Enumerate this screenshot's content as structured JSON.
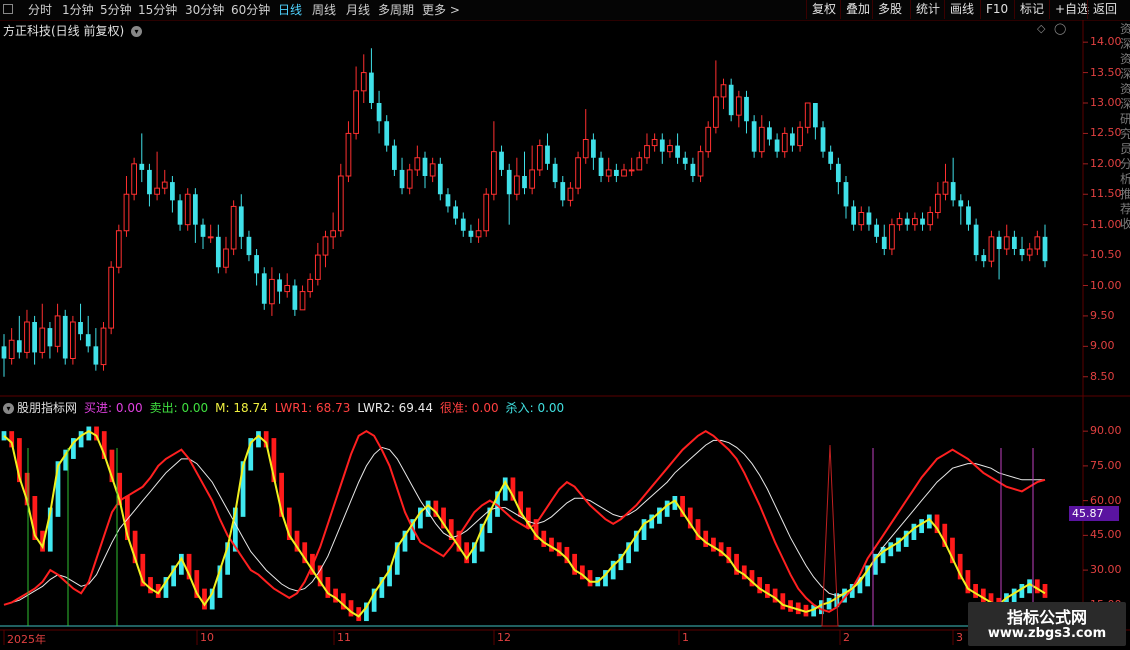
{
  "toolbar": {
    "periods": [
      "分时",
      "1分钟",
      "5分钟",
      "15分钟",
      "30分钟",
      "60分钟",
      "日线",
      "周线",
      "月线",
      "多周期",
      "更多"
    ],
    "active": "日线",
    "right_buttons": [
      "复权",
      "叠加",
      "多股",
      "统计",
      "画线",
      "F10",
      "标记",
      "+自选",
      "返回"
    ]
  },
  "main_pane": {
    "title": "方正科技(日线 前复权)",
    "y_labels": [
      "14.00",
      "13.50",
      "13.00",
      "12.50",
      "12.00",
      "11.50",
      "11.00",
      "10.50",
      "10.00",
      "9.50",
      "9.00",
      "8.50"
    ]
  },
  "indicator_pane": {
    "name": "股朋指标网",
    "items": [
      {
        "label": "买进:",
        "value": "0.00",
        "color": "#e040e0"
      },
      {
        "label": "卖出:",
        "value": "0.00",
        "color": "#40e040"
      },
      {
        "label": "M:",
        "value": "18.74",
        "color": "#f0f040"
      },
      {
        "label": "LWR1:",
        "value": "68.73",
        "color": "#ff4040"
      },
      {
        "label": "LWR2:",
        "value": "69.44",
        "color": "#e8e8e8"
      },
      {
        "label": "很准:",
        "value": "0.00",
        "color": "#ff4040"
      },
      {
        "label": "杀入:",
        "value": "0.00",
        "color": "#40e0e0"
      }
    ],
    "y_labels": [
      "90.00",
      "75.00",
      "60.00",
      "45.00",
      "30.00",
      "15.00"
    ],
    "highlight_value": "45.87"
  },
  "x_axis": {
    "labels": [
      "2025年",
      "10",
      "11",
      "12",
      "1",
      "2",
      "3"
    ]
  },
  "side_text": "资深资深资深研究员分析推荐收",
  "watermark": {
    "title": "指标公式网",
    "url": "www.zbgs3.com"
  },
  "colors": {
    "up": "#ff3030",
    "down": "#40e0e8",
    "bg": "#000000",
    "grid": "#5a0000"
  },
  "chart_data": {
    "type": "candlestick",
    "ylim": [
      8.2,
      14.2
    ],
    "indicator_ylim": [
      5,
      100
    ],
    "candles": [
      [
        9.0,
        8.8,
        9.2,
        8.5
      ],
      [
        8.8,
        9.1,
        9.3,
        8.7
      ],
      [
        9.1,
        8.9,
        9.5,
        8.8
      ],
      [
        8.9,
        9.4,
        9.6,
        8.8
      ],
      [
        9.4,
        8.9,
        9.5,
        8.7
      ],
      [
        8.9,
        9.3,
        9.7,
        8.8
      ],
      [
        9.3,
        9.0,
        9.4,
        8.8
      ],
      [
        9.0,
        9.5,
        9.7,
        8.9
      ],
      [
        9.5,
        8.8,
        9.6,
        8.7
      ],
      [
        8.8,
        9.4,
        9.5,
        8.7
      ],
      [
        9.4,
        9.2,
        9.7,
        9.1
      ],
      [
        9.2,
        9.0,
        9.5,
        8.9
      ],
      [
        9.0,
        8.7,
        9.3,
        8.6
      ],
      [
        8.7,
        9.3,
        9.4,
        8.6
      ],
      [
        9.3,
        10.3,
        10.4,
        9.2
      ],
      [
        10.3,
        10.9,
        11.0,
        10.2
      ],
      [
        10.9,
        11.5,
        11.8,
        10.8
      ],
      [
        11.5,
        12.0,
        12.1,
        11.4
      ],
      [
        12.0,
        11.9,
        12.5,
        11.7
      ],
      [
        11.9,
        11.5,
        12.0,
        11.3
      ],
      [
        11.5,
        11.6,
        12.2,
        11.4
      ],
      [
        11.6,
        11.7,
        11.9,
        11.5
      ],
      [
        11.7,
        11.4,
        11.8,
        11.2
      ],
      [
        11.4,
        11.0,
        11.5,
        10.9
      ],
      [
        11.0,
        11.5,
        11.6,
        10.9
      ],
      [
        11.5,
        11.0,
        11.6,
        10.7
      ],
      [
        11.0,
        10.8,
        11.1,
        10.6
      ],
      [
        10.8,
        10.8,
        11.0,
        10.7
      ],
      [
        10.8,
        10.3,
        11.0,
        10.2
      ],
      [
        10.3,
        10.6,
        10.8,
        10.2
      ],
      [
        10.6,
        11.3,
        11.4,
        10.5
      ],
      [
        11.3,
        10.8,
        11.5,
        10.6
      ],
      [
        10.8,
        10.5,
        10.9,
        10.4
      ],
      [
        10.5,
        10.2,
        10.6,
        10.0
      ],
      [
        10.2,
        9.7,
        10.3,
        9.6
      ],
      [
        9.7,
        10.1,
        10.3,
        9.5
      ],
      [
        10.1,
        9.9,
        10.2,
        9.7
      ],
      [
        9.9,
        10.0,
        10.2,
        9.8
      ],
      [
        10.0,
        9.6,
        10.1,
        9.5
      ],
      [
        9.6,
        9.9,
        10.0,
        9.6
      ],
      [
        9.9,
        10.1,
        10.2,
        9.8
      ],
      [
        10.1,
        10.5,
        10.7,
        10.0
      ],
      [
        10.5,
        10.8,
        10.9,
        10.3
      ],
      [
        10.8,
        10.9,
        11.2,
        10.6
      ],
      [
        10.9,
        11.8,
        12.0,
        10.8
      ],
      [
        11.8,
        12.5,
        12.7,
        11.7
      ],
      [
        12.5,
        13.2,
        13.6,
        12.4
      ],
      [
        13.2,
        13.5,
        13.8,
        13.0
      ],
      [
        13.5,
        13.0,
        13.9,
        12.9
      ],
      [
        13.0,
        12.7,
        13.2,
        12.5
      ],
      [
        12.7,
        12.3,
        12.8,
        12.2
      ],
      [
        12.3,
        11.9,
        12.4,
        11.8
      ],
      [
        11.9,
        11.6,
        12.1,
        11.5
      ],
      [
        11.6,
        11.9,
        12.0,
        11.5
      ],
      [
        11.9,
        12.1,
        12.3,
        11.8
      ],
      [
        12.1,
        11.8,
        12.2,
        11.6
      ],
      [
        11.8,
        12.0,
        12.1,
        11.7
      ],
      [
        12.0,
        11.5,
        12.1,
        11.4
      ],
      [
        11.5,
        11.3,
        11.6,
        11.2
      ],
      [
        11.3,
        11.1,
        11.4,
        11.0
      ],
      [
        11.1,
        10.9,
        11.2,
        10.8
      ],
      [
        10.9,
        10.8,
        11.0,
        10.7
      ],
      [
        10.8,
        10.9,
        11.1,
        10.7
      ],
      [
        10.9,
        11.5,
        11.6,
        10.8
      ],
      [
        11.5,
        12.2,
        12.7,
        11.4
      ],
      [
        12.2,
        11.9,
        12.3,
        11.8
      ],
      [
        11.9,
        11.5,
        12.0,
        11.0
      ],
      [
        11.5,
        11.8,
        12.1,
        11.4
      ],
      [
        11.8,
        11.6,
        12.2,
        11.5
      ],
      [
        11.6,
        11.9,
        12.3,
        11.5
      ],
      [
        11.9,
        12.3,
        12.4,
        11.8
      ],
      [
        12.3,
        12.0,
        12.5,
        11.9
      ],
      [
        12.0,
        11.7,
        12.1,
        11.6
      ],
      [
        11.7,
        11.4,
        11.8,
        11.3
      ],
      [
        11.4,
        11.6,
        11.7,
        11.3
      ],
      [
        11.6,
        12.1,
        12.2,
        11.5
      ],
      [
        12.1,
        12.4,
        12.9,
        12.0
      ],
      [
        12.4,
        12.1,
        12.5,
        11.9
      ],
      [
        12.1,
        11.8,
        12.2,
        11.7
      ],
      [
        11.8,
        11.9,
        12.1,
        11.7
      ],
      [
        11.9,
        11.8,
        12.0,
        11.7
      ],
      [
        11.8,
        11.9,
        12.0,
        11.8
      ],
      [
        11.9,
        11.9,
        12.1,
        11.8
      ],
      [
        11.9,
        12.1,
        12.2,
        11.9
      ],
      [
        12.1,
        12.3,
        12.5,
        12.0
      ],
      [
        12.3,
        12.4,
        12.5,
        12.2
      ],
      [
        12.4,
        12.2,
        12.5,
        12.0
      ],
      [
        12.2,
        12.3,
        12.4,
        12.1
      ],
      [
        12.3,
        12.1,
        12.5,
        12.0
      ],
      [
        12.1,
        12.0,
        12.2,
        11.9
      ],
      [
        12.0,
        11.8,
        12.1,
        11.7
      ],
      [
        11.8,
        12.2,
        12.3,
        11.7
      ],
      [
        12.2,
        12.6,
        12.7,
        12.1
      ],
      [
        12.6,
        13.1,
        13.7,
        12.5
      ],
      [
        13.1,
        13.3,
        13.4,
        12.9
      ],
      [
        13.3,
        12.8,
        13.4,
        12.7
      ],
      [
        12.8,
        13.1,
        13.2,
        12.6
      ],
      [
        13.1,
        12.7,
        13.2,
        12.5
      ],
      [
        12.7,
        12.2,
        12.8,
        12.1
      ],
      [
        12.2,
        12.6,
        12.8,
        12.1
      ],
      [
        12.6,
        12.4,
        12.7,
        12.3
      ],
      [
        12.4,
        12.2,
        12.5,
        12.1
      ],
      [
        12.2,
        12.5,
        12.6,
        12.1
      ],
      [
        12.5,
        12.3,
        12.6,
        12.2
      ],
      [
        12.3,
        12.6,
        12.7,
        12.2
      ],
      [
        12.6,
        13.0,
        13.0,
        12.5
      ],
      [
        13.0,
        12.6,
        13.0,
        12.4
      ],
      [
        12.6,
        12.2,
        12.7,
        12.1
      ],
      [
        12.2,
        12.0,
        12.3,
        11.9
      ],
      [
        12.0,
        11.7,
        12.1,
        11.5
      ],
      [
        11.7,
        11.3,
        11.8,
        11.1
      ],
      [
        11.3,
        11.0,
        11.4,
        10.9
      ],
      [
        11.0,
        11.2,
        11.3,
        10.9
      ],
      [
        11.2,
        11.0,
        11.3,
        10.9
      ],
      [
        11.0,
        10.8,
        11.1,
        10.7
      ],
      [
        10.8,
        10.6,
        11.0,
        10.5
      ],
      [
        10.6,
        11.0,
        11.1,
        10.5
      ],
      [
        11.0,
        11.1,
        11.2,
        10.9
      ],
      [
        11.1,
        11.0,
        11.2,
        10.9
      ],
      [
        11.0,
        11.1,
        11.2,
        10.9
      ],
      [
        11.1,
        11.0,
        11.2,
        10.9
      ],
      [
        11.0,
        11.2,
        11.3,
        10.9
      ],
      [
        11.2,
        11.5,
        11.7,
        11.1
      ],
      [
        11.5,
        11.7,
        12.0,
        11.4
      ],
      [
        11.7,
        11.4,
        12.1,
        11.3
      ],
      [
        11.4,
        11.3,
        11.5,
        11.0
      ],
      [
        11.3,
        11.0,
        11.4,
        10.9
      ],
      [
        11.0,
        10.5,
        11.1,
        10.4
      ],
      [
        10.5,
        10.4,
        10.6,
        10.3
      ],
      [
        10.4,
        10.8,
        10.9,
        10.3
      ],
      [
        10.8,
        10.6,
        10.9,
        10.1
      ],
      [
        10.6,
        10.8,
        11.0,
        10.5
      ],
      [
        10.8,
        10.6,
        10.9,
        10.5
      ],
      [
        10.6,
        10.5,
        10.8,
        10.4
      ],
      [
        10.5,
        10.6,
        10.7,
        10.4
      ],
      [
        10.6,
        10.8,
        10.9,
        10.5
      ],
      [
        10.8,
        10.4,
        11.0,
        10.3
      ]
    ],
    "series": [
      {
        "name": "M",
        "values": [
          88,
          85,
          70,
          60,
          45,
          40,
          55,
          75,
          80,
          85,
          88,
          90,
          88,
          80,
          70,
          60,
          45,
          35,
          25,
          22,
          20,
          25,
          30,
          35,
          28,
          20,
          15,
          20,
          30,
          40,
          55,
          75,
          85,
          88,
          85,
          70,
          55,
          45,
          40,
          35,
          30,
          25,
          20,
          18,
          15,
          12,
          10,
          14,
          20,
          25,
          30,
          40,
          45,
          50,
          55,
          58,
          55,
          50,
          45,
          40,
          35,
          40,
          48,
          55,
          62,
          68,
          62,
          55,
          50,
          45,
          42,
          40,
          38,
          35,
          30,
          28,
          25,
          25,
          28,
          32,
          35,
          40,
          45,
          50,
          52,
          55,
          58,
          60,
          55,
          50,
          45,
          42,
          40,
          38,
          35,
          30,
          28,
          25,
          22,
          20,
          18,
          15,
          14,
          13,
          12,
          13,
          15,
          16,
          18,
          20,
          22,
          25,
          30,
          35,
          38,
          40,
          42,
          45,
          48,
          50,
          52,
          48,
          42,
          35,
          28,
          22,
          20,
          18,
          16,
          15,
          18,
          20,
          22,
          24,
          22,
          20
        ]
      },
      {
        "name": "LWR1",
        "values": [
          15,
          16,
          18,
          20,
          22,
          25,
          30,
          28,
          25,
          22,
          20,
          25,
          35,
          45,
          55,
          60,
          62,
          64,
          66,
          70,
          75,
          78,
          80,
          82,
          78,
          72,
          66,
          60,
          52,
          45,
          40,
          35,
          30,
          28,
          25,
          22,
          20,
          18,
          20,
          25,
          32,
          40,
          50,
          60,
          70,
          80,
          88,
          90,
          88,
          82,
          75,
          65,
          55,
          48,
          42,
          40,
          38,
          36,
          40,
          45,
          50,
          55,
          58,
          60,
          58,
          55,
          52,
          50,
          48,
          50,
          55,
          60,
          65,
          68,
          66,
          62,
          58,
          55,
          52,
          50,
          52,
          55,
          58,
          62,
          66,
          70,
          74,
          78,
          82,
          85,
          88,
          90,
          88,
          85,
          82,
          78,
          72,
          65,
          58,
          50,
          42,
          35,
          28,
          22,
          18,
          15,
          13,
          12,
          14,
          18,
          22,
          28,
          35,
          40,
          45,
          50,
          55,
          60,
          65,
          70,
          74,
          78,
          80,
          82,
          80,
          78,
          75,
          72,
          70,
          68,
          66,
          65,
          64,
          66,
          68,
          69
        ]
      },
      {
        "name": "LWR2",
        "values": [
          15,
          16,
          17,
          19,
          21,
          23,
          26,
          28,
          27,
          25,
          23,
          24,
          28,
          35,
          42,
          48,
          52,
          56,
          60,
          64,
          68,
          72,
          75,
          78,
          78,
          76,
          72,
          68,
          62,
          56,
          50,
          44,
          38,
          34,
          30,
          27,
          24,
          22,
          21,
          22,
          25,
          30,
          36,
          44,
          52,
          60,
          68,
          75,
          80,
          83,
          82,
          78,
          72,
          66,
          60,
          55,
          50,
          46,
          44,
          45,
          47,
          50,
          53,
          56,
          57,
          57,
          55,
          53,
          51,
          50,
          51,
          53,
          56,
          59,
          61,
          61,
          60,
          58,
          56,
          54,
          53,
          54,
          56,
          59,
          62,
          65,
          68,
          72,
          75,
          78,
          81,
          84,
          86,
          86,
          85,
          83,
          80,
          76,
          71,
          65,
          58,
          51,
          44,
          38,
          32,
          27,
          23,
          20,
          19,
          20,
          22,
          26,
          30,
          35,
          40,
          44,
          48,
          52,
          56,
          60,
          64,
          68,
          71,
          74,
          75,
          76,
          76,
          75,
          74,
          72,
          71,
          70,
          69,
          69,
          69,
          69
        ]
      }
    ]
  }
}
